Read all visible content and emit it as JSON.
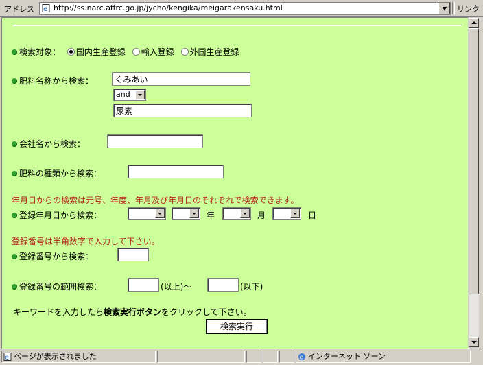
{
  "address_bar": {
    "label": "アドレス",
    "url": "http://ss.narc.affrc.go.jp/jycho/kengika/meigarakensaku.html",
    "links_label": "リンク"
  },
  "form": {
    "target": {
      "label": "検索対象：",
      "options": [
        "国内生産登録",
        "輸入登録",
        "外国生産登録"
      ],
      "selected": "国内生産登録"
    },
    "fertilizer_name": {
      "label": "肥料名称から検索：",
      "value1": "くみあい",
      "operator": "and",
      "value2": "尿素"
    },
    "company": {
      "label": "会社名から検索：",
      "value": ""
    },
    "fertilizer_type": {
      "label": "肥料の種類から検索：",
      "value": ""
    },
    "date_note": "年月日からの検索は元号、年度、年月及び年月日のそれぞれで検索できます。",
    "date": {
      "label": "登録年月日から検索：",
      "era": "",
      "year_num": "",
      "year_unit": "年",
      "month": "",
      "month_unit": "月",
      "day": "",
      "day_unit": "日"
    },
    "number_note": "登録番号は半角数字で入力して下さい。",
    "reg_number": {
      "label": "登録番号から検索：",
      "value": ""
    },
    "range": {
      "label": "登録番号の範囲検索：",
      "from": "",
      "from_suffix": "(以上)～",
      "to": "",
      "to_suffix": "(以下)"
    },
    "instruction_pre": "キーワードを入力したら",
    "instruction_bold": "検索実行ボタン",
    "instruction_post": "をクリックして下さい。",
    "submit_label": "検索実行"
  },
  "status_bar": {
    "message": "ページが表示されました",
    "zone": "インターネット ゾーン"
  },
  "colors": {
    "page_bg": "#ccff99",
    "bullet": "#2e9e2e",
    "note_text": "#b3261e"
  }
}
